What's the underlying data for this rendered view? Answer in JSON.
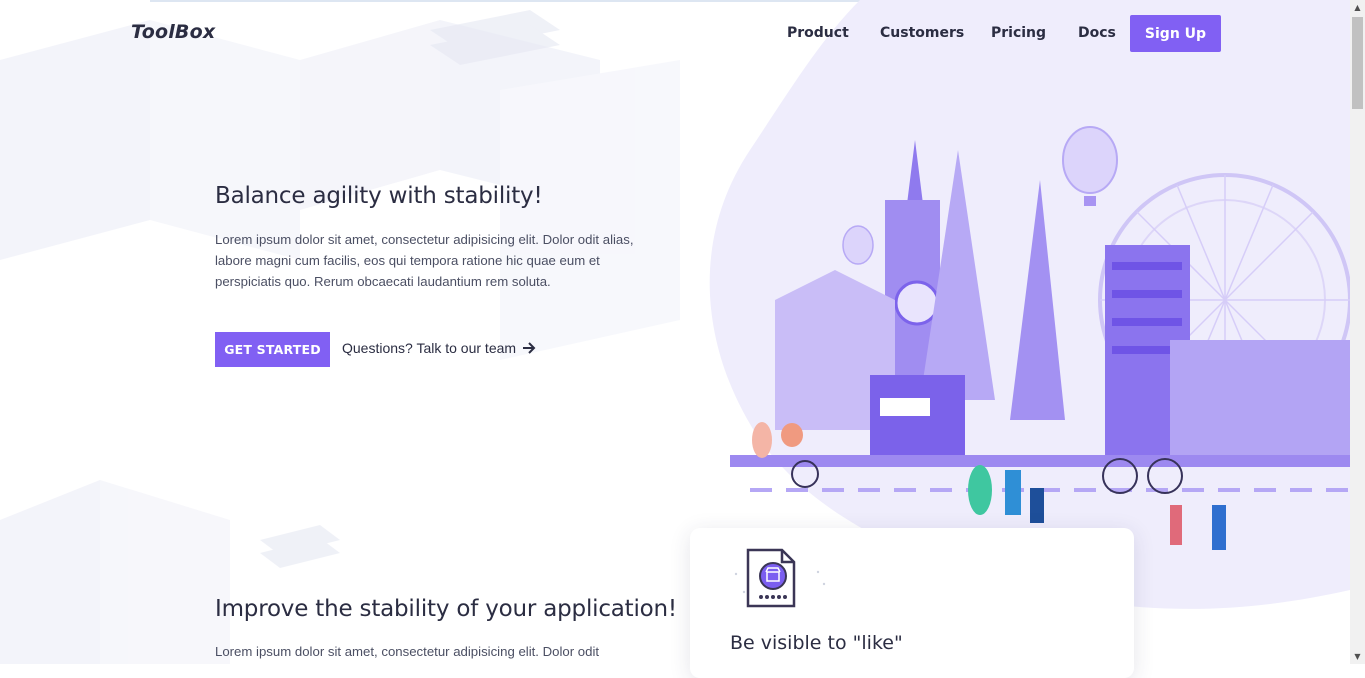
{
  "brand": {
    "name": "ToolBox",
    "accent": "#8160f3"
  },
  "nav": {
    "items": [
      {
        "label": "Product"
      },
      {
        "label": "Customers"
      },
      {
        "label": "Pricing"
      },
      {
        "label": "Docs"
      }
    ],
    "signup_label": "Sign Up"
  },
  "hero": {
    "title": "Balance agility with stability!",
    "body": "Lorem ipsum dolor sit amet, consectetur adipisicing elit. Dolor odit alias, labore magni cum facilis, eos qui tempora ratione hic quae eum et perspiciatis quo. Rerum obcaecati laudantium rem soluta.",
    "cta_label": "GET STARTED",
    "talk_label": "Questions? Talk to our team",
    "talk_icon": "arrow-right-icon"
  },
  "section2": {
    "title": "Improve the stability of your application!",
    "body": "Lorem ipsum dolor sit amet, consectetur adipisicing elit. Dolor odit"
  },
  "card": {
    "icon": "store-rating-icon",
    "title": "Be visible to \"like\""
  },
  "illustration": {
    "name": "city-landmarks-illustration"
  }
}
